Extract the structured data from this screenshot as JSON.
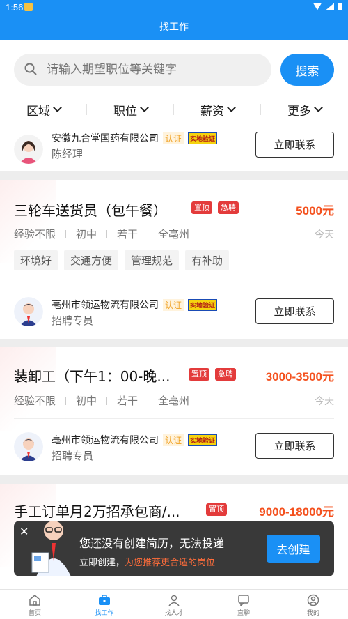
{
  "status": {
    "time": "1:56"
  },
  "header": {
    "title": "找工作"
  },
  "search": {
    "placeholder": "请输入期望职位等关键字",
    "button": "搜索"
  },
  "filters": [
    {
      "label": "区域"
    },
    {
      "label": "职位"
    },
    {
      "label": "薪资"
    },
    {
      "label": "更多"
    }
  ],
  "partial_card": {
    "company": "安徽九合堂国药有限公司",
    "cert": "认证",
    "real": "实地验证",
    "contact": "陈经理",
    "button": "立即联系"
  },
  "jobs": [
    {
      "title": "三轮车送货员（包午餐）",
      "tags": [
        "置顶",
        "急聘"
      ],
      "salary": "5000元",
      "meta": [
        "经验不限",
        "初中",
        "若干",
        "全亳州"
      ],
      "date": "今天",
      "benefits": [
        "环境好",
        "交通方便",
        "管理规范",
        "有补助"
      ],
      "company": "亳州市领运物流有限公司",
      "cert": "认证",
      "real": "实地验证",
      "contact": "招聘专员",
      "button": "立即联系"
    },
    {
      "title": "装卸工（下午1：00-晚...",
      "tags": [
        "置顶",
        "急聘"
      ],
      "salary": "3000-3500元",
      "meta": [
        "经验不限",
        "初中",
        "若干",
        "全亳州"
      ],
      "date": "今天",
      "company": "亳州市领运物流有限公司",
      "cert": "认证",
      "real": "实地验证",
      "contact": "招聘专员",
      "button": "立即联系"
    },
    {
      "title": "手工订单月2万招承包商/...",
      "tags": [
        "置顶"
      ],
      "salary": "9000-18000元"
    }
  ],
  "popup": {
    "message": "您还没有创建简历，无法投递",
    "sub_prefix": "立即创建，",
    "sub_highlight": "为您推荐更合适的岗位",
    "button": "去创建"
  },
  "nav": [
    {
      "label": "首页",
      "icon": "home-icon"
    },
    {
      "label": "找工作",
      "icon": "briefcase-icon",
      "active": true
    },
    {
      "label": "找人才",
      "icon": "people-icon"
    },
    {
      "label": "直聊",
      "icon": "chat-icon"
    },
    {
      "label": "我的",
      "icon": "profile-icon"
    }
  ],
  "colors": {
    "primary": "#1a90f5",
    "salary": "#f4511e",
    "tag": "#e33b3b"
  }
}
